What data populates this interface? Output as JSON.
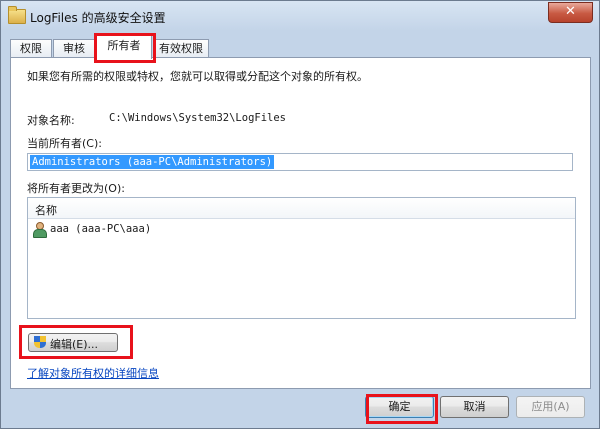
{
  "window": {
    "title": "LogFiles 的高级安全设置",
    "close_label": "✕"
  },
  "tabs": [
    {
      "label": "权限"
    },
    {
      "label": "审核"
    },
    {
      "label": "所有者"
    },
    {
      "label": "有效权限"
    }
  ],
  "owner_page": {
    "intro": "如果您有所需的权限或特权，您就可以取得或分配这个对象的所有权。",
    "object_name_label": "对象名称:",
    "object_name_value": "C:\\Windows\\System32\\LogFiles",
    "current_owner_label": "当前所有者(C):",
    "current_owner_value": "Administrators (aaa-PC\\Administrators)",
    "change_owner_label": "将所有者更改为(O):",
    "list_header": "名称",
    "list_items": [
      "aaa (aaa-PC\\aaa)"
    ],
    "edit_button": "编辑(E)...",
    "learn_link": "了解对象所有权的详细信息"
  },
  "footer": {
    "ok": "确定",
    "cancel": "取消",
    "apply": "应用(A)"
  },
  "icons": {
    "window": "folder-icon",
    "user": "user-icon",
    "edit": "uac-shield-icon"
  },
  "colors": {
    "highlight_box": "#e8121b",
    "selection": "#3399ff",
    "link": "#0645c0"
  }
}
